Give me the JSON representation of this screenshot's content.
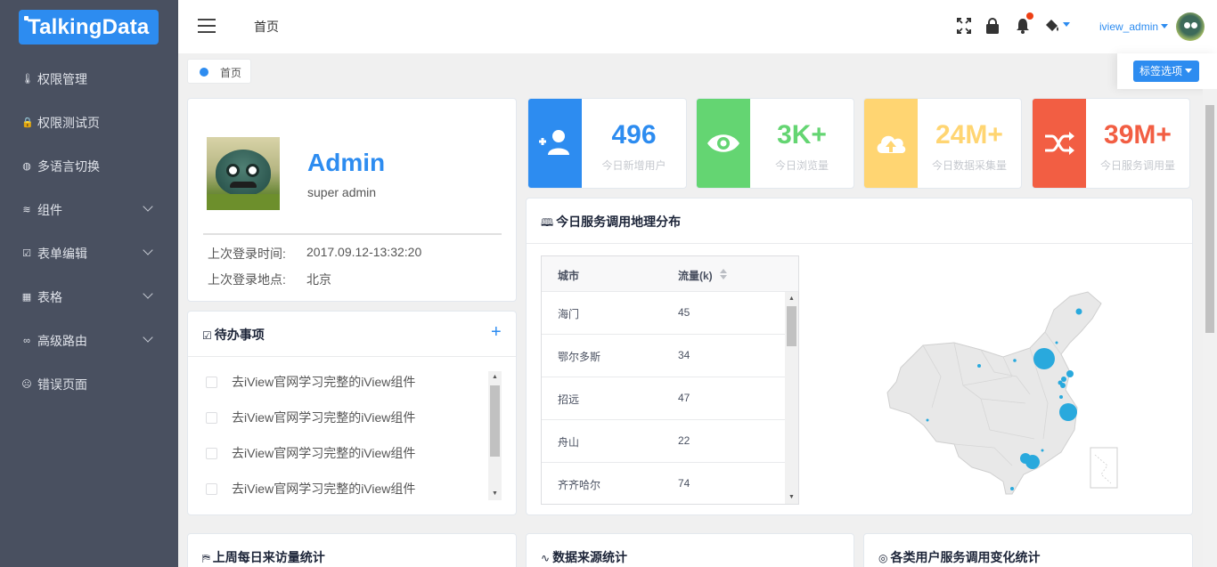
{
  "app": {
    "logo_text": "TalkingData"
  },
  "sidebar": {
    "items": [
      {
        "label": "权限管理",
        "icon": "thermometer-icon",
        "glyph": "🌡"
      },
      {
        "label": "权限测试页",
        "icon": "lock-icon",
        "glyph": "🔒"
      },
      {
        "label": "多语言切换",
        "icon": "globe-icon",
        "glyph": "◍"
      },
      {
        "label": "组件",
        "icon": "layers-icon",
        "glyph": "≋",
        "expandable": true
      },
      {
        "label": "表单编辑",
        "icon": "check-square-icon",
        "glyph": "☑",
        "expandable": true
      },
      {
        "label": "表格",
        "icon": "grid-icon",
        "glyph": "▦",
        "expandable": true
      },
      {
        "label": "高级路由",
        "icon": "infinity-icon",
        "glyph": "∞",
        "expandable": true
      },
      {
        "label": "错误页面",
        "icon": "sad-face-icon",
        "glyph": "☹"
      }
    ]
  },
  "header": {
    "breadcrumb": "首页",
    "user_name": "iview_admin",
    "icons": [
      "fullscreen-icon",
      "lock-icon",
      "bell-icon",
      "paint-bucket-icon"
    ]
  },
  "tagbar": {
    "active_tag": "首页",
    "options_label": "标签选项"
  },
  "profile": {
    "name": "Admin",
    "role": "super admin",
    "last_login_time_label": "上次登录时间:",
    "last_login_time": "2017.09.12-13:32:20",
    "last_login_place_label": "上次登录地点:",
    "last_login_place": "北京"
  },
  "todo": {
    "title": "待办事项",
    "add_symbol": "+",
    "items": [
      "去iView官网学习完整的iView组件",
      "去iView官网学习完整的iView组件",
      "去iView官网学习完整的iView组件",
      "去iView官网学习完整的iView组件"
    ]
  },
  "stats": [
    {
      "value": "496",
      "label": "今日新增用户",
      "color": "#2d8cf0",
      "icon": "add-user-icon"
    },
    {
      "value": "3K+",
      "label": "今日浏览量",
      "color": "#64d572",
      "icon": "eye-icon"
    },
    {
      "value": "24M+",
      "label": "今日数据采集量",
      "color": "#ffd572",
      "icon": "upload-cloud-icon"
    },
    {
      "value": "39M+",
      "label": "今日服务调用量",
      "color": "#f25e43",
      "icon": "shuffle-icon"
    }
  ],
  "geo": {
    "title": "今日服务调用地理分布",
    "columns": [
      "城市",
      "流量(k)"
    ],
    "rows": [
      [
        "海门",
        "45"
      ],
      [
        "鄂尔多斯",
        "34"
      ],
      [
        "招远",
        "47"
      ],
      [
        "舟山",
        "22"
      ],
      [
        "齐齐哈尔",
        "74"
      ]
    ]
  },
  "bottom_cards": [
    {
      "title": "上周每日来访量统计",
      "icon": "map-icon"
    },
    {
      "title": "数据来源统计",
      "icon": "pulse-icon"
    },
    {
      "title": "各类用户服务调用变化统计",
      "icon": "target-icon"
    }
  ]
}
